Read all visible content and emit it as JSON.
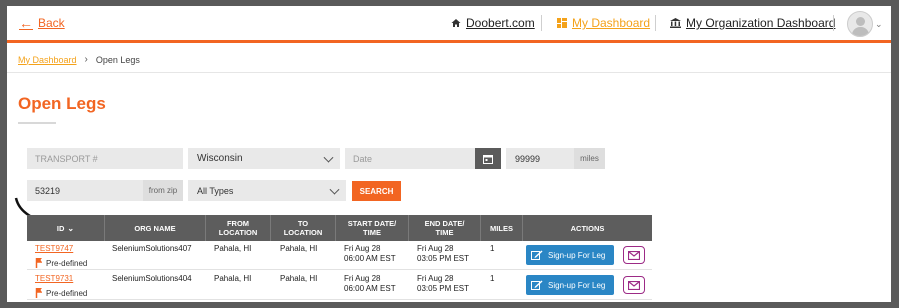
{
  "nav": {
    "back_label": "Back",
    "links": [
      {
        "label": "Doobert.com",
        "icon": "home-icon"
      },
      {
        "label": "My Dashboard",
        "icon": "dashboard-icon"
      },
      {
        "label": "My Organization Dashboard",
        "icon": "bank-icon"
      }
    ],
    "avatar_icon": "user-avatar-icon"
  },
  "breadcrumb": {
    "parent": "My Dashboard",
    "current": "Open Legs"
  },
  "page": {
    "title": "Open Legs"
  },
  "filters": {
    "transport_placeholder": "TRANSPORT #",
    "state_value": "Wisconsin",
    "date_placeholder": "Date",
    "distance_value": "99999",
    "distance_unit": "miles",
    "zip_value": "53219",
    "zip_addon": "from zip",
    "type_value": "All Types",
    "search_label": "SEARCH"
  },
  "table": {
    "columns": [
      "ID",
      "ORG NAME",
      "FROM LOCATION",
      "TO LOCATION",
      "START DATE/ TIME",
      "END DATE/ TIME",
      "MILES",
      "ACTIONS"
    ],
    "rows": [
      {
        "id": "TEST9747",
        "type": "Pre-defined",
        "org": "SeleniumSolutions407",
        "from": "Pahala, HI",
        "to": "Pahala, HI",
        "start_date": "Fri Aug 28",
        "start_time": "06:00 AM EST",
        "end_date": "Fri Aug 28",
        "end_time": "03:05 PM EST",
        "miles": "1",
        "action_label": "Sign-up For Leg"
      },
      {
        "id": "TEST9731",
        "type": "Pre-defined",
        "org": "SeleniumSolutions404",
        "from": "Pahala, HI",
        "to": "Pahala, HI",
        "start_date": "Fri Aug 28",
        "start_time": "06:00 AM EST",
        "end_date": "Fri Aug 28",
        "end_time": "03:05 PM EST",
        "miles": "1",
        "action_label": "Sign-up For Leg"
      }
    ]
  },
  "colors": {
    "accent": "#f26522",
    "link_yellow": "#f4a21a",
    "header_gray": "#5d5d5d",
    "button_blue": "#2a86c5",
    "mail_purple": "#9c2a86"
  }
}
